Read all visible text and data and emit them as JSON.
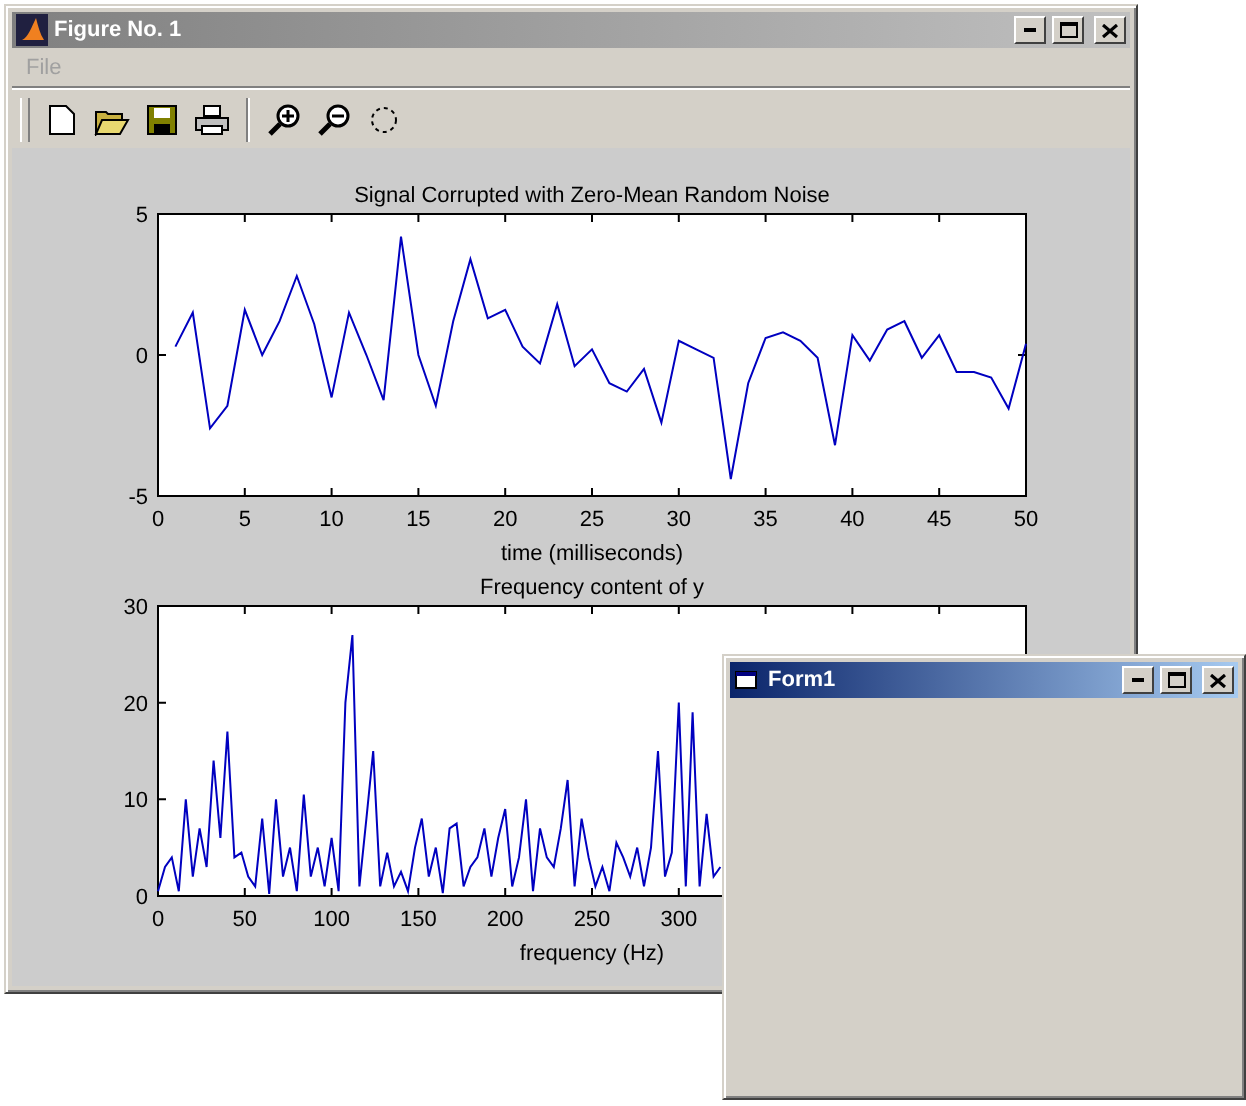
{
  "windows": [
    {
      "kind": "figure",
      "title": "Figure No. 1",
      "active": false,
      "menu": [
        {
          "label": "File",
          "disabled": true
        }
      ],
      "toolbar": [
        {
          "kind": "new"
        },
        {
          "kind": "open"
        },
        {
          "kind": "save"
        },
        {
          "kind": "print"
        },
        {
          "kind": "zoom-in"
        },
        {
          "kind": "zoom-out"
        },
        {
          "kind": "rotate"
        }
      ],
      "charts": [
        {
          "chart_data": {
            "type": "line",
            "title": "Signal Corrupted with Zero-Mean Random Noise",
            "xlabel": "time (milliseconds)",
            "xlim": [
              0,
              50
            ],
            "ylim": [
              -5,
              5
            ],
            "xticks": [
              0,
              5,
              10,
              15,
              20,
              25,
              30,
              35,
              40,
              45,
              50
            ],
            "yticks": [
              -5,
              0,
              5
            ],
            "x": [
              1,
              2,
              3,
              4,
              5,
              6,
              7,
              8,
              9,
              10,
              11,
              12,
              13,
              14,
              15,
              16,
              17,
              18,
              19,
              20,
              21,
              22,
              23,
              24,
              25,
              26,
              27,
              28,
              29,
              30,
              31,
              32,
              33,
              34,
              35,
              36,
              37,
              38,
              39,
              40,
              41,
              42,
              43,
              44,
              45,
              46,
              47,
              48,
              49,
              50
            ],
            "series": [
              {
                "color": "#0000c0",
                "values": [
                  0.3,
                  1.5,
                  -2.6,
                  -1.8,
                  1.6,
                  0,
                  1.2,
                  2.8,
                  1.1,
                  -1.5,
                  1.5,
                  0,
                  -1.6,
                  4.2,
                  0,
                  -1.8,
                  1.2,
                  3.4,
                  1.3,
                  1.6,
                  0.3,
                  -0.3,
                  1.8,
                  -0.4,
                  0.2,
                  -1,
                  -1.3,
                  -0.5,
                  -2.4,
                  0.5,
                  0.2,
                  -0.1,
                  -4.4,
                  -1,
                  0.6,
                  0.8,
                  0.5,
                  -0.1,
                  -3.2,
                  0.7,
                  -0.2,
                  0.9,
                  1.2,
                  -0.1,
                  0.7,
                  -0.6,
                  -0.6,
                  -0.8,
                  -1.9,
                  0.4
                ]
              }
            ]
          }
        },
        {
          "chart_data": {
            "type": "line",
            "title": "Frequency content of y",
            "xlabel": "frequency (Hz)",
            "xlim": [
              0,
              500
            ],
            "ylim": [
              0,
              30
            ],
            "xticks": [
              0,
              50,
              100,
              150,
              200,
              250,
              300
            ],
            "yticks": [
              0,
              10,
              20,
              30
            ],
            "x": [
              0,
              4,
              8,
              12,
              16,
              20,
              24,
              28,
              32,
              36,
              40,
              44,
              48,
              52,
              56,
              60,
              64,
              68,
              72,
              76,
              80,
              84,
              88,
              92,
              96,
              100,
              104,
              108,
              112,
              116,
              120,
              124,
              128,
              132,
              136,
              140,
              144,
              148,
              152,
              156,
              160,
              164,
              168,
              172,
              176,
              180,
              184,
              188,
              192,
              196,
              200,
              204,
              208,
              212,
              216,
              220,
              224,
              228,
              232,
              236,
              240,
              244,
              248,
              252,
              256,
              260,
              264,
              268,
              272,
              276,
              280,
              284,
              288,
              292,
              296,
              300,
              304,
              308,
              312,
              316,
              320,
              324
            ],
            "series": [
              {
                "color": "#0000c0",
                "values": [
                  0.5,
                  3,
                  4,
                  0.5,
                  10,
                  2,
                  7,
                  3,
                  14,
                  6,
                  17,
                  4,
                  4.5,
                  2,
                  1,
                  8,
                  0.2,
                  10,
                  2,
                  5,
                  0.5,
                  10.5,
                  2,
                  5,
                  1,
                  6,
                  0.5,
                  20,
                  27,
                  1,
                  8,
                  15,
                  1,
                  4.5,
                  1,
                  2.5,
                  0.5,
                  5,
                  8,
                  2,
                  5,
                  0.3,
                  7,
                  7.5,
                  1,
                  3,
                  4,
                  7,
                  2,
                  6,
                  9,
                  1,
                  4,
                  10,
                  0.5,
                  7,
                  4,
                  3,
                  7,
                  12,
                  1,
                  8,
                  4,
                  1,
                  3,
                  0.5,
                  5.5,
                  4,
                  2,
                  5,
                  1,
                  5,
                  15,
                  2,
                  4.5,
                  20,
                  1,
                  19,
                  1,
                  8.5,
                  2,
                  3
                ]
              }
            ]
          }
        }
      ]
    },
    {
      "kind": "form",
      "title": "Form1",
      "active": true
    }
  ]
}
